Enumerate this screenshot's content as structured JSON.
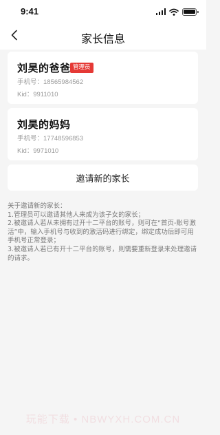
{
  "status_bar": {
    "time": "9:41",
    "icons": [
      "signal-icon",
      "wifi-icon",
      "battery-icon"
    ]
  },
  "nav": {
    "back_icon": "chevron-left-icon",
    "title": "家长信息"
  },
  "parents": [
    {
      "name": "刘昊的爸爸",
      "badge": "管理员",
      "phone": "手机号：18565984562",
      "kid": "Kid：9911010"
    },
    {
      "name": "刘昊的妈妈",
      "phone": "手机号：17748596853",
      "kid": "Kid：9971010"
    }
  ],
  "invite_button": "邀请新的家长",
  "notes": [
    "关于邀请新的家长：",
    "1.管理员可以邀请其他人来成为该子女的家长；",
    "2.被邀请人若从未拥有过开十二平台的账号，则可在“首页-账号激活”中，输入手机号与收到的激活码进行绑定，绑定成功后即可用手机号正常登录；",
    "3.被邀请人若已有开十二平台的账号，则需要重新登录来处理邀请的请求。"
  ],
  "watermark": "玩能下载 • NBWYXH.COM.CN",
  "colors": {
    "background": "#f5f5f5",
    "card": "#ffffff",
    "badge": "#e53935",
    "secondary_text": "#9a9a9a"
  }
}
